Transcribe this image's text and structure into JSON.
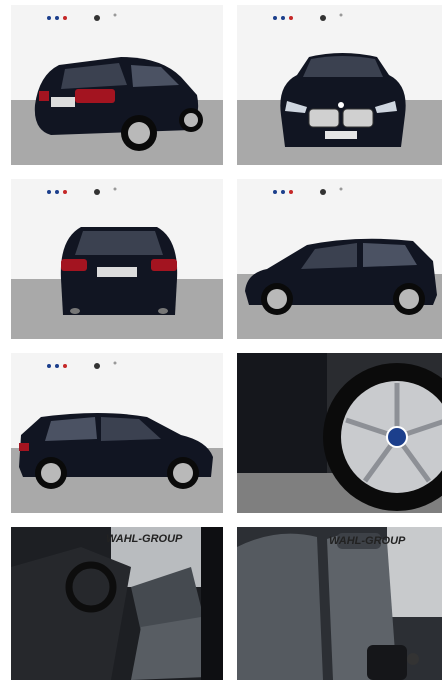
{
  "gallery": {
    "tiles": [
      {
        "view": "rear-three-quarter",
        "watermark": ""
      },
      {
        "view": "front",
        "watermark": ""
      },
      {
        "view": "rear",
        "watermark": ""
      },
      {
        "view": "side",
        "watermark": ""
      },
      {
        "view": "side-left",
        "watermark": ""
      },
      {
        "view": "wheel-closeup",
        "watermark": ""
      },
      {
        "view": "interior-cockpit",
        "watermark": "WAHL-GROUP"
      },
      {
        "view": "interior-seats",
        "watermark": "WAHL-GROUP"
      }
    ]
  },
  "colors": {
    "car_body": "#111522",
    "backdrop": "#f4f4f4",
    "floor": "#a9a9a9",
    "seat_fabric": "#555a60"
  }
}
